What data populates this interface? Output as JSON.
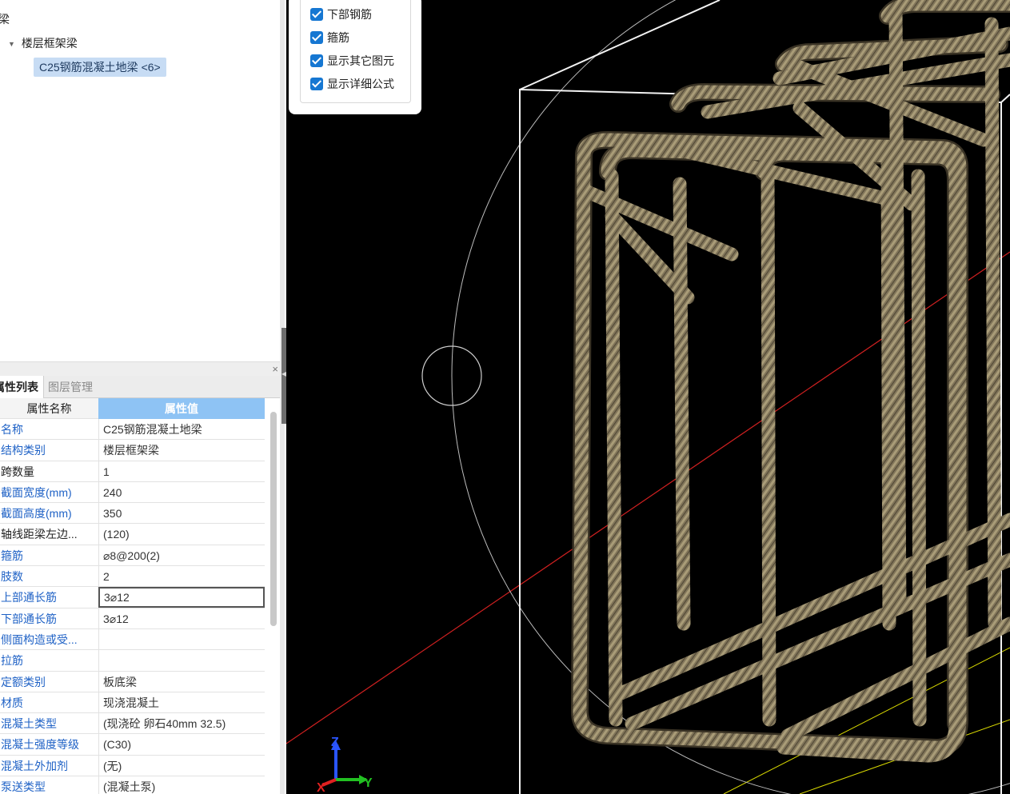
{
  "tree": {
    "root_label": "梁",
    "group_label": "楼层框架梁",
    "group_caret": "▼",
    "selected_item": "C25钢筋混凝土地梁 <6>"
  },
  "dock": {
    "close_glyph": "×"
  },
  "tabs": {
    "properties": "属性列表",
    "layers": "图层管理"
  },
  "property_table": {
    "header_name": "属性名称",
    "header_value": "属性值",
    "rows": [
      {
        "name": "名称",
        "value": "C25钢筋混凝土地梁"
      },
      {
        "name": "结构类别",
        "value": "楼层框架梁"
      },
      {
        "name": "跨数量",
        "value": "1"
      },
      {
        "name": "截面宽度(mm)",
        "value": "240"
      },
      {
        "name": "截面高度(mm)",
        "value": "350"
      },
      {
        "name": "轴线距梁左边...",
        "value": "(120)"
      },
      {
        "name": "箍筋",
        "value": "⌀8@200(2)"
      },
      {
        "name": "肢数",
        "value": "2"
      },
      {
        "name": "上部通长筋",
        "value": "3⌀12"
      },
      {
        "name": "下部通长筋",
        "value": "3⌀12"
      },
      {
        "name": "侧面构造或受...",
        "value": ""
      },
      {
        "name": "拉筋",
        "value": ""
      },
      {
        "name": "定额类别",
        "value": "板底梁"
      },
      {
        "name": "材质",
        "value": "现浇混凝土"
      },
      {
        "name": "混凝土类型",
        "value": "(现浇砼 卵石40mm 32.5)"
      },
      {
        "name": "混凝土强度等级",
        "value": "(C30)"
      },
      {
        "name": "混凝土外加剂",
        "value": "(无)"
      },
      {
        "name": "泵送类型",
        "value": "(混凝土泵)"
      }
    ]
  },
  "display_options": [
    {
      "label": "下部钢筋",
      "checked": true
    },
    {
      "label": "箍筋",
      "checked": true
    },
    {
      "label": "显示其它图元",
      "checked": true
    },
    {
      "label": "显示详细公式",
      "checked": true
    }
  ],
  "axes": {
    "z": "Z",
    "x": "X",
    "y": "Y"
  },
  "colors": {
    "selection": "#c7dcf4",
    "link_blue": "#1f62c6",
    "header_blue": "#8ec3f4",
    "checkbox_blue": "#1677d2",
    "viewport_bg": "#000000",
    "rebar": "#8b7d5c"
  }
}
